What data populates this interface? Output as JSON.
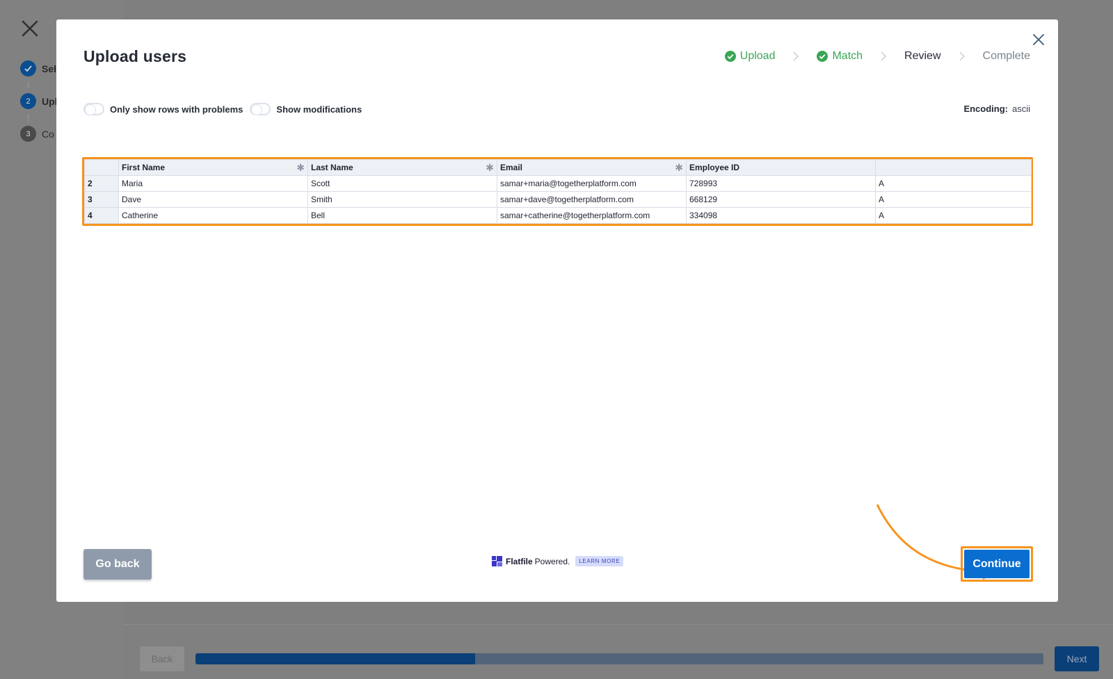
{
  "background": {
    "sidebar_steps": [
      {
        "num": "",
        "label": "Sel",
        "state": "done"
      },
      {
        "num": "2",
        "label": "Upl",
        "state": "current"
      },
      {
        "num": "3",
        "label": "Co",
        "state": "todo"
      }
    ],
    "footer": {
      "back_label": "Back",
      "next_label": "Next",
      "progress_fraction": 0.33
    }
  },
  "modal": {
    "title": "Upload users",
    "steps": [
      {
        "label": "Upload",
        "state": "done"
      },
      {
        "label": "Match",
        "state": "done"
      },
      {
        "label": "Review",
        "state": "current"
      },
      {
        "label": "Complete",
        "state": "todo"
      }
    ],
    "toggles": [
      {
        "label": "Only show rows with problems",
        "on": false
      },
      {
        "label": "Show modifications",
        "on": false
      }
    ],
    "encoding": {
      "label": "Encoding:",
      "value": "ascii"
    },
    "grid": {
      "columns": [
        {
          "label": "First Name",
          "required": true
        },
        {
          "label": "Last Name",
          "required": true
        },
        {
          "label": "Email",
          "required": true
        },
        {
          "label": "Employee ID",
          "required": false
        },
        {
          "label": "",
          "required": false
        }
      ],
      "rows": [
        {
          "num": "2",
          "cells": [
            "Maria",
            "Scott",
            "samar+maria@togetherplatform.com",
            "728993",
            "A"
          ]
        },
        {
          "num": "3",
          "cells": [
            "Dave",
            "Smith",
            "samar+dave@togetherplatform.com",
            "668129",
            "A"
          ]
        },
        {
          "num": "4",
          "cells": [
            "Catherine",
            "Bell",
            "samar+catherine@togetherplatform.com",
            "334098",
            "A"
          ]
        }
      ]
    },
    "footer": {
      "go_back_label": "Go back",
      "powered_brand": "Flatfile",
      "powered_text": "Powered.",
      "learn_more": "LEARN MORE",
      "continue_label": "Continue"
    },
    "colors": {
      "done": "#3aa654",
      "accent": "#0a6ed1",
      "highlight": "#f7931e"
    },
    "required_marker": "✱"
  }
}
